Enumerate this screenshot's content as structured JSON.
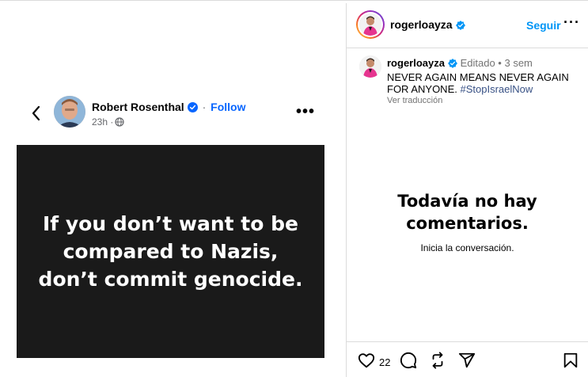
{
  "facebook_post": {
    "author": "Robert Rosenthal",
    "separator": "·",
    "follow_label": "Follow",
    "time": "23h ·",
    "quote": "If you don’t want to be compared to Nazis, don’t commit genocide."
  },
  "instagram": {
    "header": {
      "username": "rogerloayza",
      "follow_label": "Seguir",
      "more": "···"
    },
    "caption": {
      "username": "rogerloayza",
      "meta": "Editado • 3 sem",
      "text": "NEVER AGAIN MEANS NEVER AGAIN FOR ANYONE.",
      "hashtag": "#StopIsraelNow",
      "translate": "Ver traducción"
    },
    "empty": {
      "title": "Todavía no hay comentarios.",
      "subtitle": "Inicia la conversación."
    },
    "actions": {
      "likes": "22"
    }
  },
  "colors": {
    "fb_blue": "#0866ff",
    "ig_blue": "#0095f6",
    "card_bg": "#1a1a1a"
  },
  "icons": [
    "back-arrow-icon",
    "verified-icon",
    "globe-icon",
    "more-icon",
    "heart-icon",
    "comment-icon",
    "repost-icon",
    "share-icon",
    "bookmark-icon"
  ]
}
